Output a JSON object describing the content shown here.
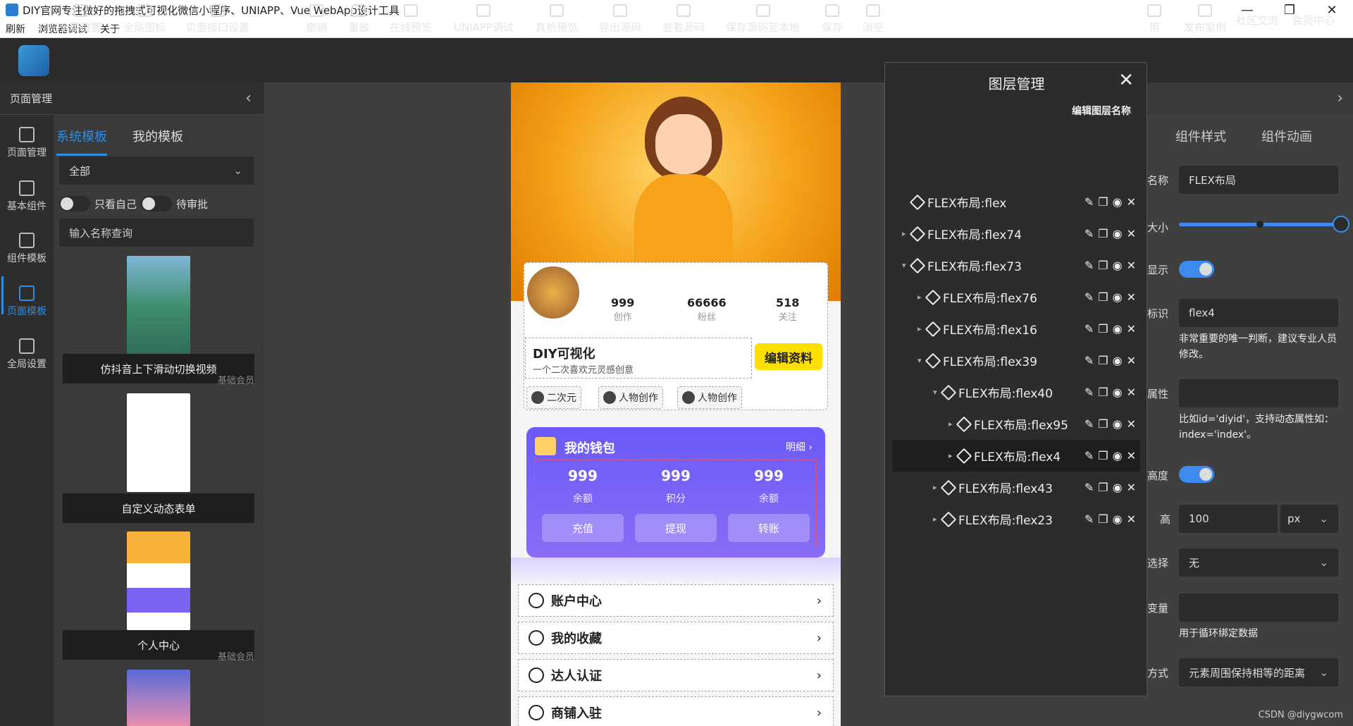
{
  "window": {
    "title": "DIY官网专注做好的拖拽式可视化微信小程序、UNIAPP、Vue WebApp设计工具",
    "controls": [
      "—",
      "❐",
      "✕"
    ]
  },
  "menu": [
    "刷新",
    "浏览器调试",
    "关于"
  ],
  "toolbar": {
    "items": [
      "全局设置",
      "全局图标",
      "页面接口设置",
      "撤销",
      "重做",
      "在线预览",
      "UNIAPP调试",
      "真机预览",
      "导出源码",
      "查看源码",
      "保存源码至本地",
      "保存",
      "消空"
    ],
    "right": [
      "用",
      "发布案例",
      "社区交流",
      "会员中心"
    ]
  },
  "left": {
    "header": "页面管理",
    "rail": [
      "页面管理",
      "基本组件",
      "组件模板",
      "页面模板",
      "全局设置"
    ],
    "tabs": [
      "系统模板",
      "我的模板"
    ],
    "select": "全部",
    "toggle1": "只看自己",
    "toggle2": "待审批",
    "search_placeholder": "输入名称查询",
    "cards": [
      {
        "title": "仿抖音上下滑动切换视频",
        "badge": "基础会员"
      },
      {
        "title": "自定义动态表单",
        "badge": ""
      },
      {
        "title": "个人中心",
        "badge": "基础会员"
      }
    ]
  },
  "phone": {
    "stats": [
      {
        "v": "999",
        "k": "创作"
      },
      {
        "v": "66666",
        "k": "粉丝"
      },
      {
        "v": "518",
        "k": "关注"
      }
    ],
    "diy_title": "DIY可视化",
    "diy_sub": "一个二次喜欢元灵感创意",
    "edit_btn": "编辑资料",
    "tags": [
      "二次元",
      "人物创作",
      "人物创作"
    ],
    "wallet": {
      "title": "我的钱包",
      "more": "明细 ›",
      "cols": [
        {
          "v": "999",
          "k": "余额",
          "b": "充值"
        },
        {
          "v": "999",
          "k": "积分",
          "b": "提现"
        },
        {
          "v": "999",
          "k": "余额",
          "b": "转账"
        }
      ]
    },
    "rows": [
      "账户中心",
      "我的收藏",
      "达人认证",
      "商铺入驻"
    ]
  },
  "layers": {
    "title": "图层管理",
    "edit": "编辑图层名称",
    "items": [
      {
        "label": "FLEX布局:flex",
        "indent": 0,
        "arrow": ""
      },
      {
        "label": "FLEX布局:flex74",
        "indent": 0,
        "arrow": "▸"
      },
      {
        "label": "FLEX布局:flex73",
        "indent": 0,
        "arrow": "▾"
      },
      {
        "label": "FLEX布局:flex76",
        "indent": 1,
        "arrow": "▸"
      },
      {
        "label": "FLEX布局:flex16",
        "indent": 1,
        "arrow": "▸"
      },
      {
        "label": "FLEX布局:flex39",
        "indent": 1,
        "arrow": "▾"
      },
      {
        "label": "FLEX布局:flex40",
        "indent": 2,
        "arrow": "▾"
      },
      {
        "label": "FLEX布局:flex95",
        "indent": 3,
        "arrow": "▸"
      },
      {
        "label": "FLEX布局:flex4",
        "indent": 3,
        "arrow": "▸",
        "selected": true
      },
      {
        "label": "FLEX布局:flex43",
        "indent": 2,
        "arrow": "▸"
      },
      {
        "label": "FLEX布局:flex23",
        "indent": 2,
        "arrow": "▸"
      }
    ]
  },
  "right": {
    "tabs": [
      "组件样式",
      "组件动画"
    ],
    "name_label": "名称",
    "name_value": "FLEX布局",
    "size_label": "大小",
    "show_label": "显示",
    "id_label": "标识",
    "id_value": "flex4",
    "id_hint": "非常重要的唯一判断，建议专业人员修改。",
    "attr_label": "属性",
    "attr_hint": "比如id='diyid'，支持动态属性如：index='index'。",
    "height_switch_label": "高度",
    "h_label": "高",
    "h_value": "100",
    "h_unit": "px",
    "select_label": "选择",
    "select_value": "无",
    "var_label": "变量",
    "var_hint": "用于循环绑定数据",
    "mode_label": "方式",
    "mode_value": "元素周围保持相等的距离"
  },
  "watermark": "CSDN @diygwcom"
}
